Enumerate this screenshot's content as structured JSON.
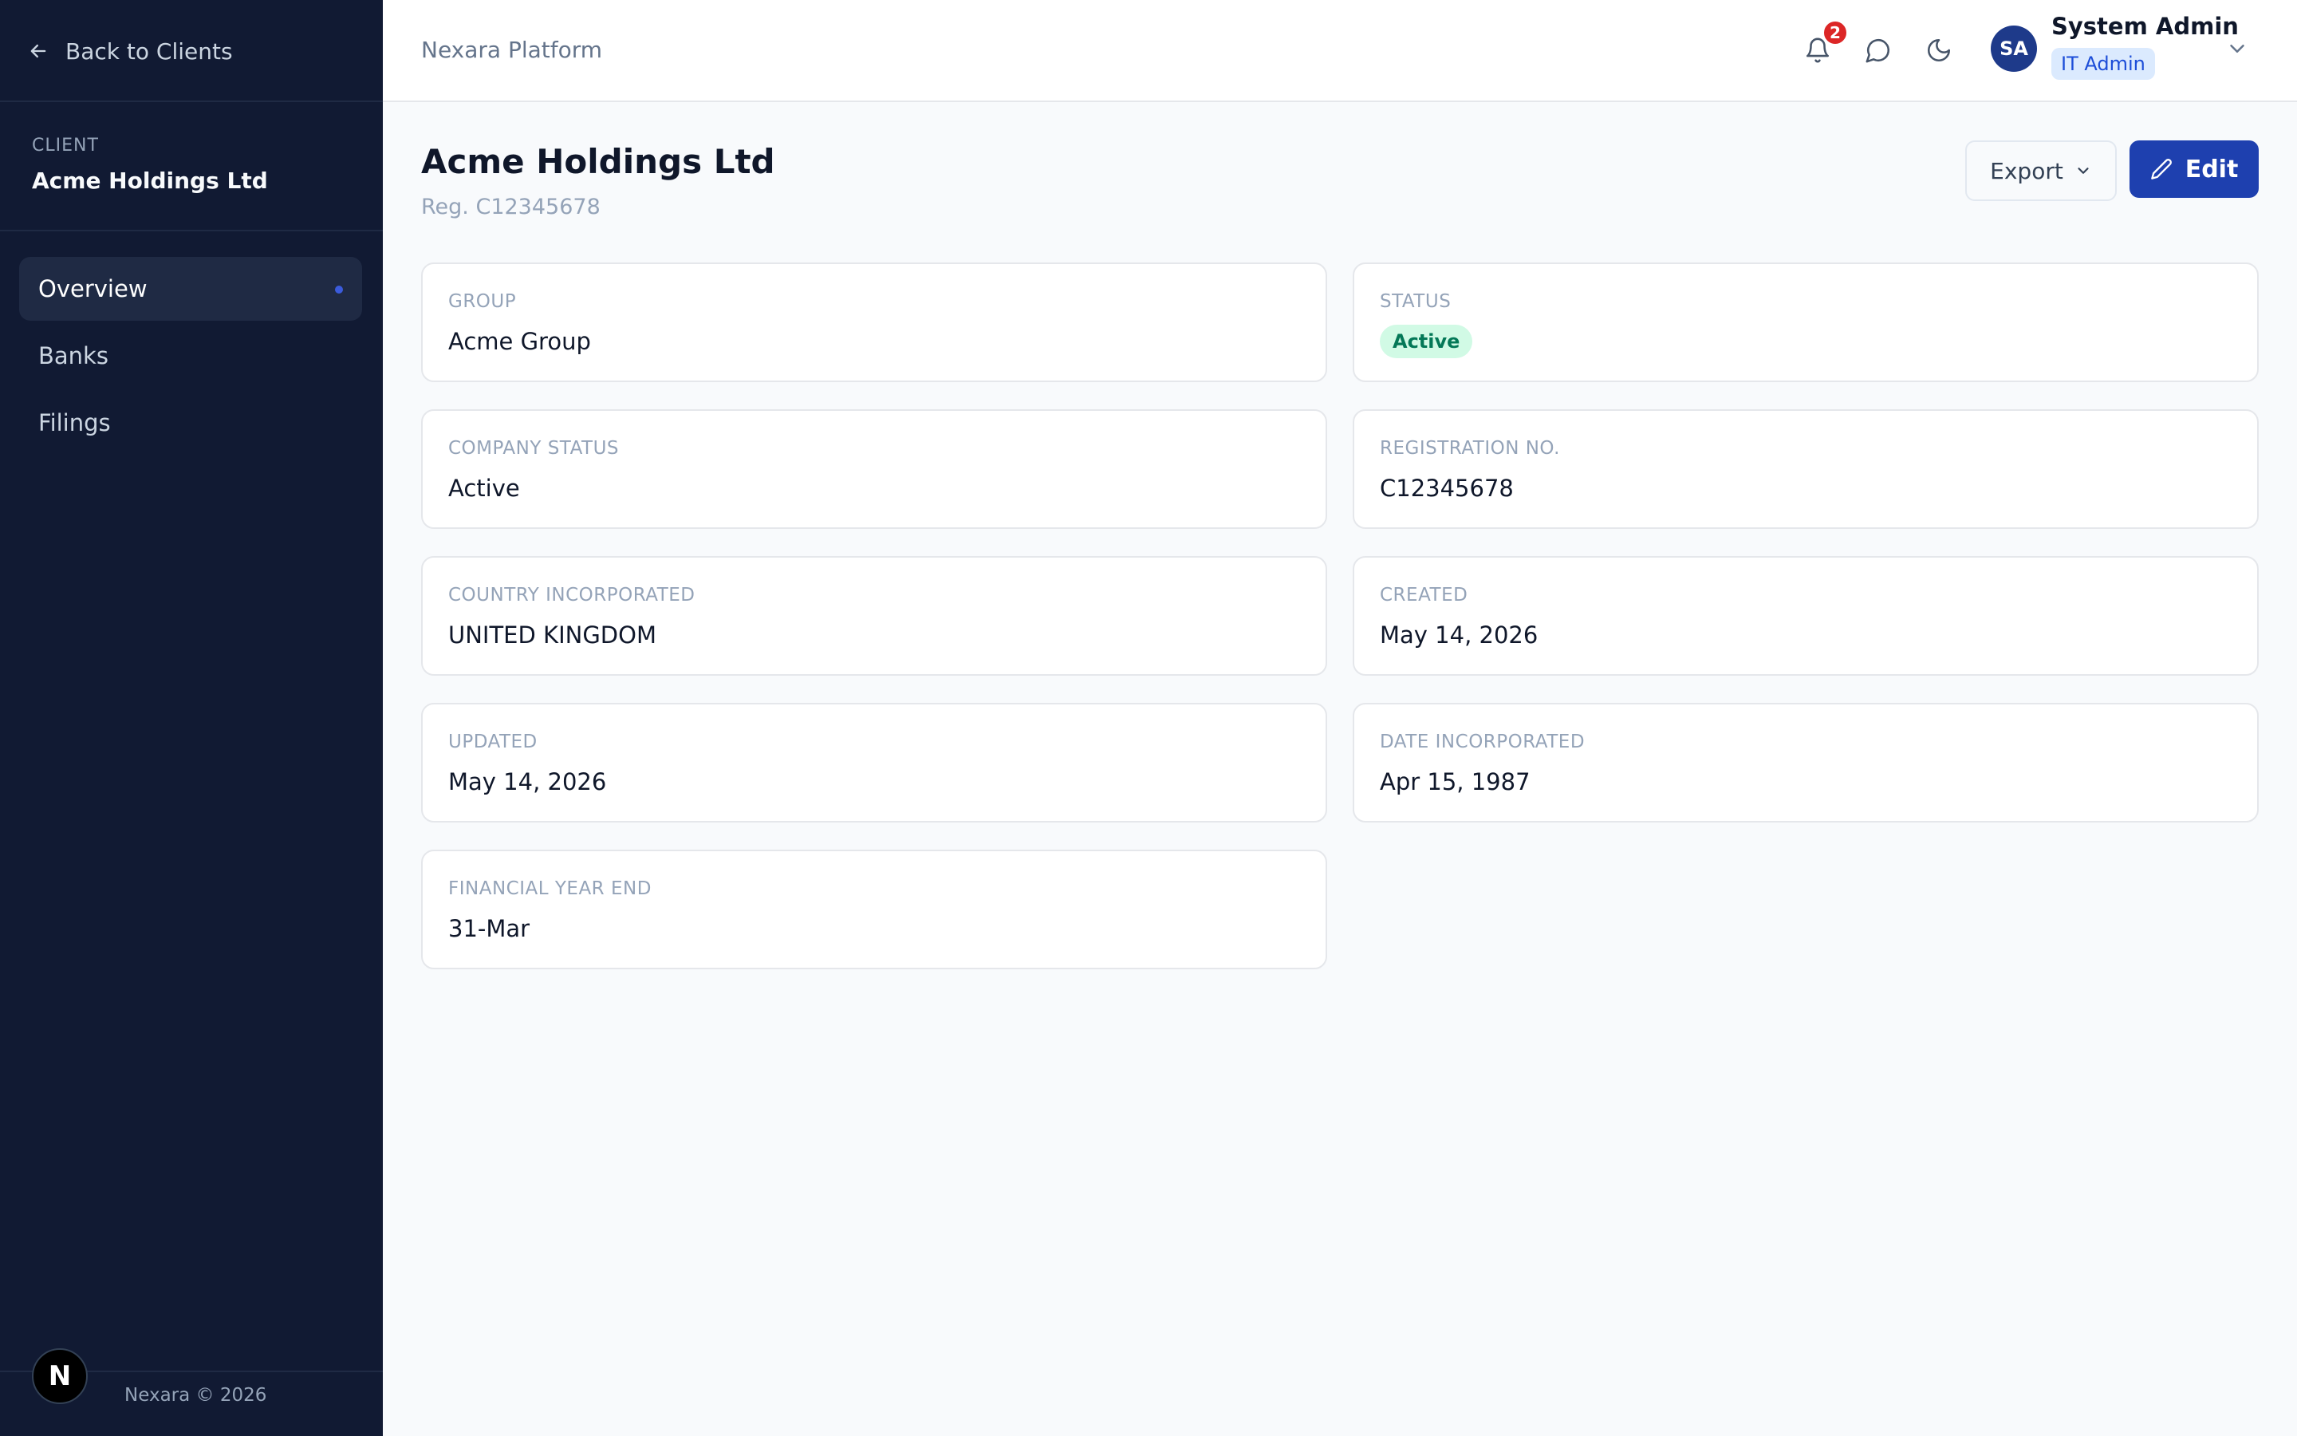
{
  "sidebar": {
    "back_label": "Back to Clients",
    "client_eyebrow": "CLIENT",
    "client_name": "Acme Holdings Ltd",
    "nav": [
      {
        "label": "Overview",
        "active": true
      },
      {
        "label": "Banks",
        "active": false
      },
      {
        "label": "Filings",
        "active": false
      }
    ],
    "logo_letter": "N",
    "footer": "Nexara © 2026"
  },
  "header": {
    "platform": "Nexara Platform",
    "notifications_count": "2",
    "icons": [
      "bell-icon",
      "chat-icon",
      "moon-icon"
    ],
    "user": {
      "initials": "SA",
      "name": "System Admin",
      "role": "IT Admin"
    }
  },
  "page": {
    "title": "Acme Holdings Ltd",
    "subtitle": "Reg. C12345678",
    "export_label": "Export",
    "edit_label": "Edit"
  },
  "fields": {
    "group": {
      "label": "GROUP",
      "value": "Acme Group"
    },
    "status": {
      "label": "STATUS",
      "value": "Active"
    },
    "company_status": {
      "label": "COMPANY STATUS",
      "value": "Active"
    },
    "registration_no": {
      "label": "REGISTRATION NO.",
      "value": "C12345678"
    },
    "country": {
      "label": "COUNTRY INCORPORATED",
      "value": "UNITED KINGDOM"
    },
    "created": {
      "label": "CREATED",
      "value": "May 14, 2026"
    },
    "updated": {
      "label": "UPDATED",
      "value": "May 14, 2026"
    },
    "date_incorporated": {
      "label": "DATE INCORPORATED",
      "value": "Apr 15, 1987"
    },
    "financial_year_end": {
      "label": "FINANCIAL YEAR END",
      "value": "31-Mar"
    }
  },
  "colors": {
    "sidebar_bg": "#111a33",
    "accent": "#1e40af",
    "status_active_bg": "#d1fae5",
    "status_active_text": "#047857",
    "notification": "#dc2626"
  }
}
